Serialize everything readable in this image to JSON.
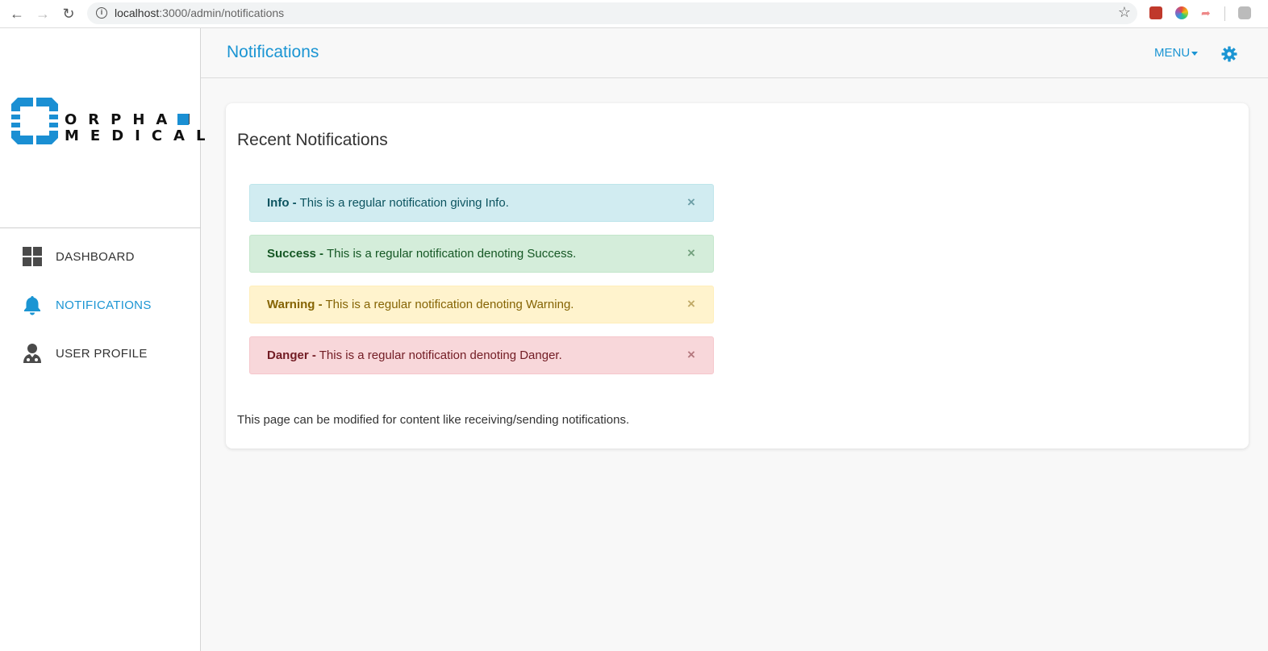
{
  "browser": {
    "url_host": "localhost",
    "url_rest": ":3000/admin/notifications"
  },
  "brand": {
    "line1": "ORPHAN",
    "line2": "MEDICAL",
    "color": "#1a8fd3"
  },
  "sidebar": {
    "items": [
      {
        "label": "DASHBOARD",
        "icon": "dashboard-grid-icon",
        "active": false
      },
      {
        "label": "NOTIFICATIONS",
        "icon": "bell-icon",
        "active": true
      },
      {
        "label": "USER PROFILE",
        "icon": "user-doctor-icon",
        "active": false
      }
    ]
  },
  "header": {
    "title": "Notifications",
    "menu_label": "MENU",
    "settings_icon": "gear-icon",
    "accent": "#1b95d3"
  },
  "card": {
    "title": "Recent Notifications",
    "alerts": [
      {
        "type": "info",
        "label": "Info -",
        "message": "This is a regular notification giving Info."
      },
      {
        "type": "success",
        "label": "Success -",
        "message": "This is a regular notification denoting Success."
      },
      {
        "type": "warning",
        "label": "Warning -",
        "message": "This is a regular notification denoting Warning."
      },
      {
        "type": "danger",
        "label": "Danger -",
        "message": "This is a regular notification denoting Danger."
      }
    ],
    "close_glyph": "×",
    "note": "This page can be modified for content like receiving/sending notifications."
  }
}
